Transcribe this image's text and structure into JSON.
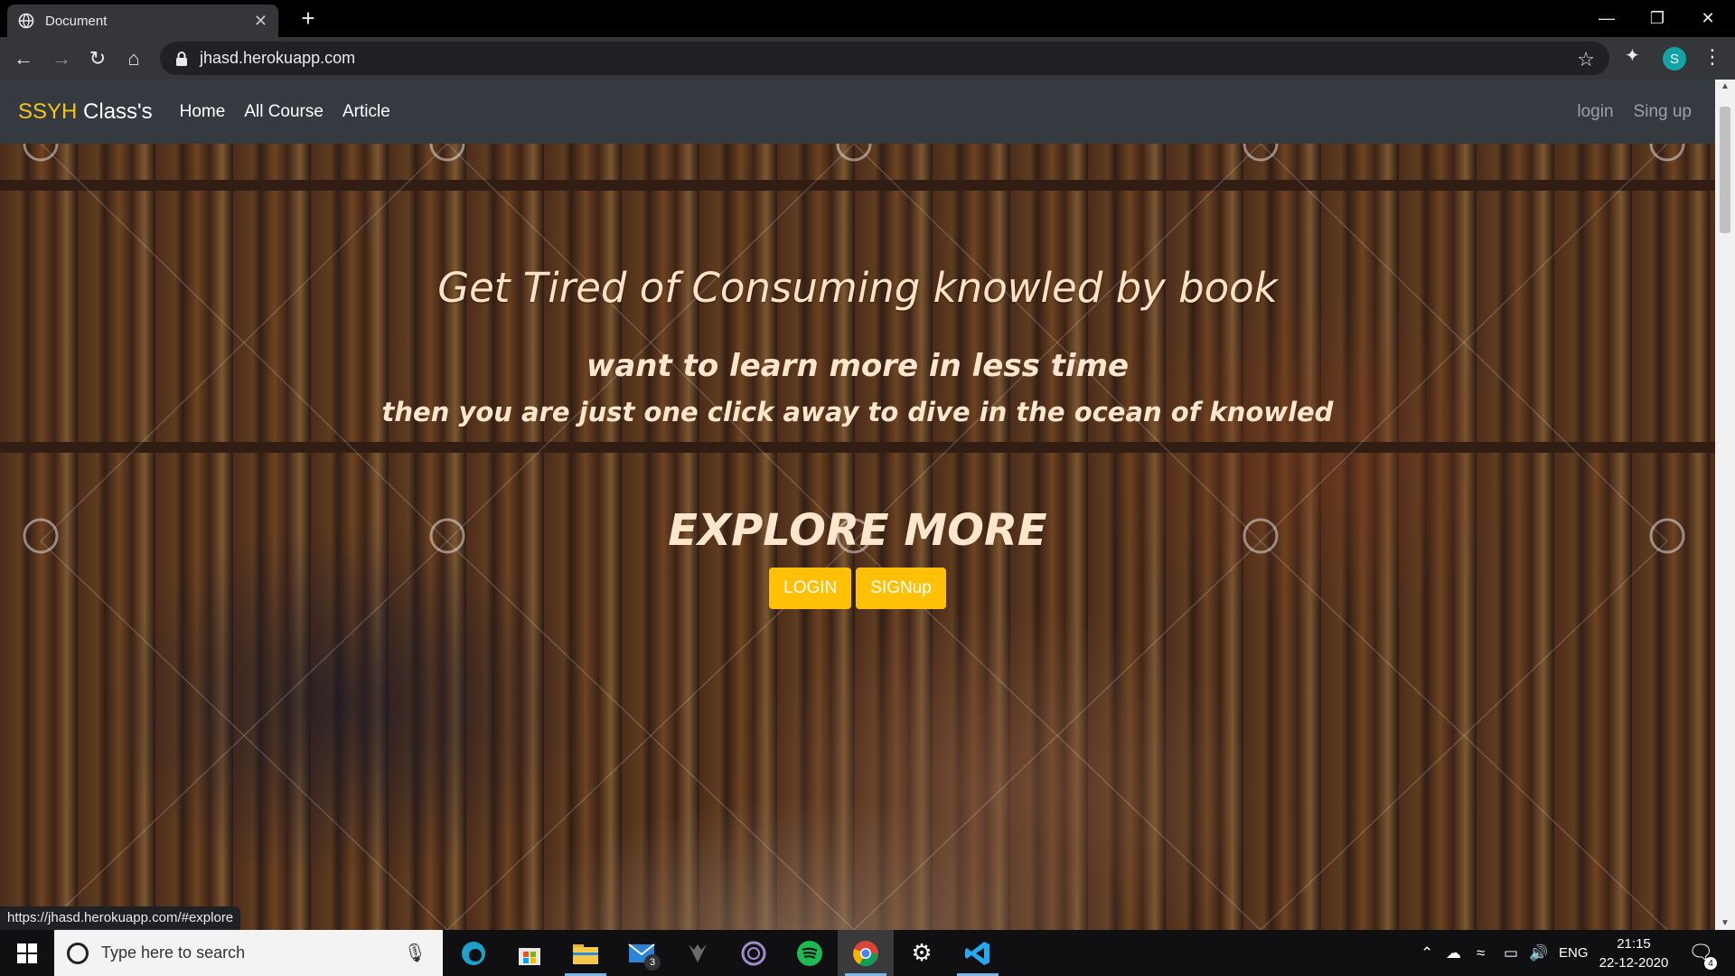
{
  "browser": {
    "tab_title": "Document",
    "tab_close": "✕",
    "new_tab": "+",
    "url": "jhasd.herokuapp.com",
    "status_url": "https://jhasd.herokuapp.com/#explore",
    "profile_initial": "S",
    "controls": {
      "minimize": "—",
      "restore": "❐",
      "close": "✕"
    }
  },
  "site": {
    "brand_accent": "SSYH",
    "brand_rest": " Class's",
    "nav": [
      "Home",
      "All Course",
      "Article"
    ],
    "nav_right": [
      "login",
      "Sing up"
    ]
  },
  "hero": {
    "title": "Get Tired of Consuming knowled by book",
    "subtitle1": "want to learn more in less time",
    "subtitle2": "then you are just one click away to dive in the ocean of knowled",
    "explore": "EXPLORE MORE",
    "login_button": "LOGIN",
    "signup_button": "SIGNup"
  },
  "taskbar": {
    "search_placeholder": "Type here to search",
    "mail_badge": "3",
    "language": "ENG",
    "time": "21:15",
    "date": "22-12-2020",
    "notification_count": "4"
  },
  "colors": {
    "navbar": "#343a40",
    "brand_accent": "#f5c518",
    "cta": "#ffc107",
    "chrome_dark": "#35363a"
  }
}
